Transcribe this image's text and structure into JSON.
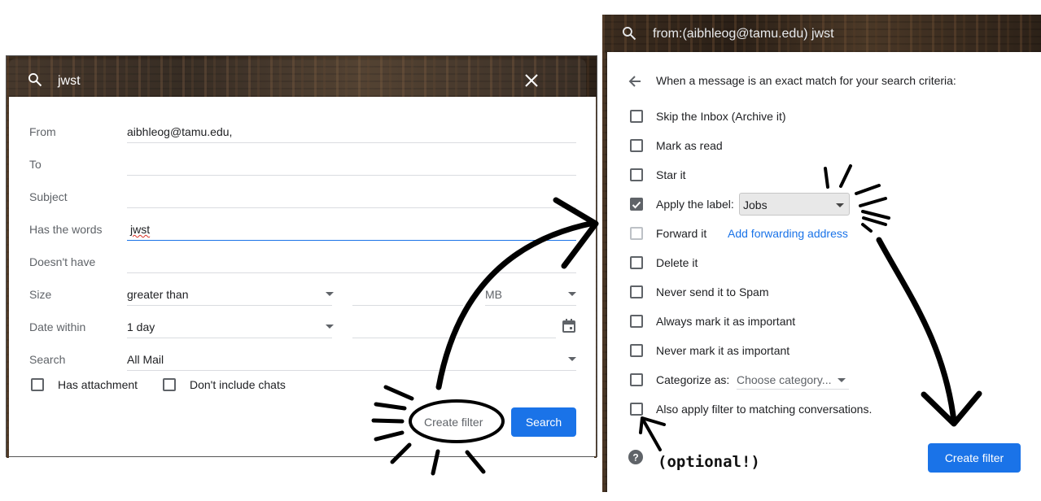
{
  "left": {
    "query": "jwst",
    "fields": [
      {
        "label": "From",
        "value": "aibhleog@tamu.edu,"
      },
      {
        "label": "To",
        "value": ""
      },
      {
        "label": "Subject",
        "value": ""
      },
      {
        "label": "Has the words",
        "value": "jwst"
      },
      {
        "label": "Doesn't have",
        "value": ""
      },
      {
        "label": "Size",
        "value": "greater than",
        "unit": "MB"
      },
      {
        "label": "Date within",
        "value": "1 day"
      },
      {
        "label": "Search",
        "value": "All Mail"
      }
    ],
    "has_attachment": "Has attachment",
    "dont_include_chats": "Don't include chats",
    "create_filter": "Create filter",
    "search": "Search"
  },
  "right": {
    "query": "from:(aibhleog@tamu.edu) jwst",
    "header": "When a message is an exact match for your search criteria:",
    "options": [
      {
        "label": "Skip the Inbox (Archive it)",
        "checked": false
      },
      {
        "label": "Mark as read",
        "checked": false
      },
      {
        "label": "Star it",
        "checked": false
      },
      {
        "label": "Apply the label:",
        "checked": true
      },
      {
        "label": "Forward it",
        "checked": false
      },
      {
        "label": "Delete it",
        "checked": false
      },
      {
        "label": "Never send it to Spam",
        "checked": false
      },
      {
        "label": "Always mark it as important",
        "checked": false
      },
      {
        "label": "Never mark it as important",
        "checked": false
      },
      {
        "label": "Categorize as:",
        "checked": false
      },
      {
        "label": "Also apply filter to matching conversations.",
        "checked": false
      }
    ],
    "label_select": "Jobs",
    "forward_link": "Add forwarding address",
    "category_select": "Choose category...",
    "create_filter": "Create filter",
    "optional_note": "(optional!)"
  },
  "colors": {
    "primary": "#1a73e8",
    "text": "#202124",
    "muted": "#5f6368"
  }
}
